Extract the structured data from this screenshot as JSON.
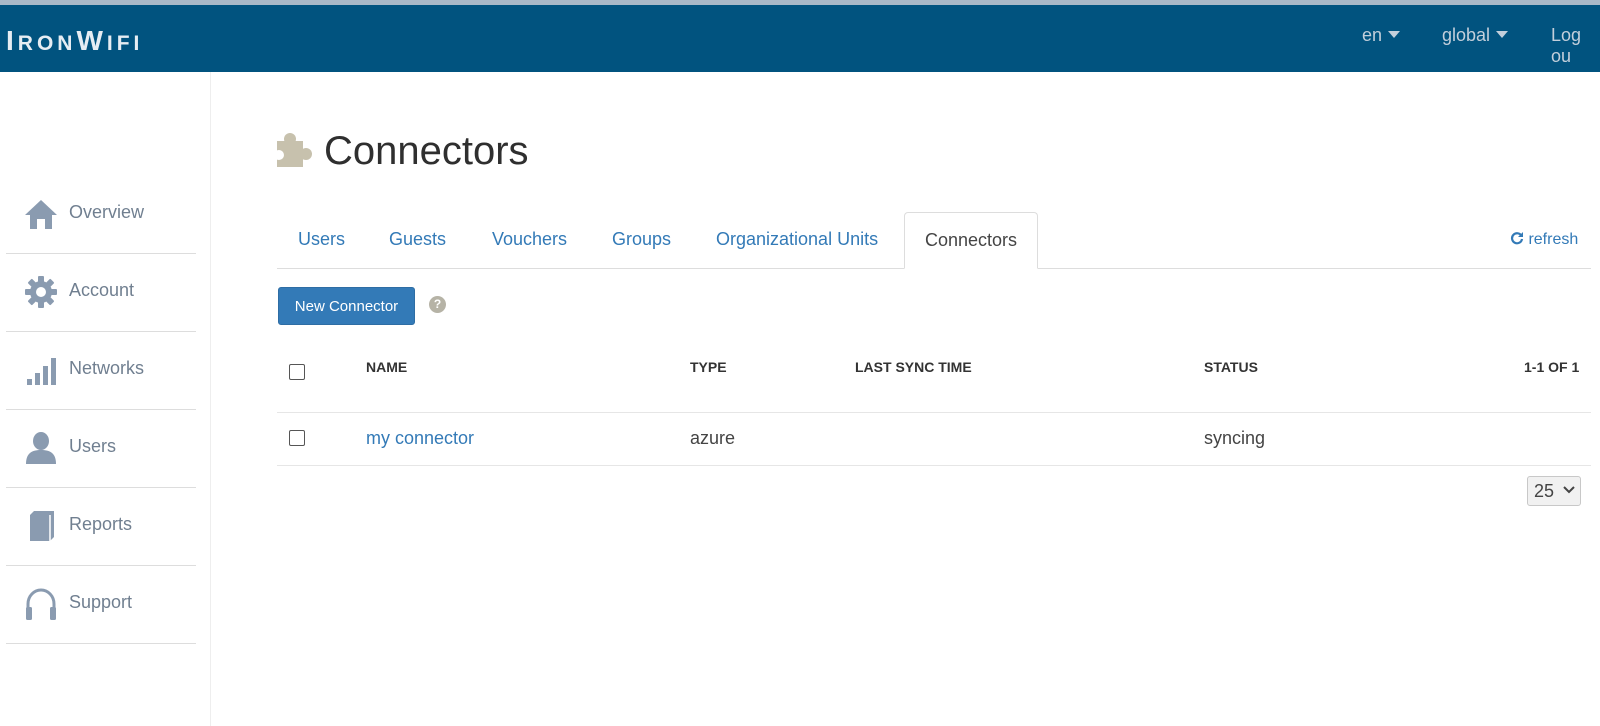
{
  "brand": {
    "first_big": "I",
    "first_rest": "RON",
    "second_big": "W",
    "second_rest": "IFI"
  },
  "topnav": {
    "language": "en",
    "scope": "global",
    "logout": "Log ou"
  },
  "sidebar": {
    "items": [
      {
        "label": "Overview",
        "icon": "home-icon"
      },
      {
        "label": "Account",
        "icon": "gear-icon"
      },
      {
        "label": "Networks",
        "icon": "signal-bars-icon"
      },
      {
        "label": "Users",
        "icon": "user-icon"
      },
      {
        "label": "Reports",
        "icon": "book-icon"
      },
      {
        "label": "Support",
        "icon": "headphones-icon"
      }
    ]
  },
  "page": {
    "title": "Connectors",
    "title_icon": "puzzle-icon"
  },
  "tabs": [
    {
      "label": "Users",
      "active": false
    },
    {
      "label": "Guests",
      "active": false
    },
    {
      "label": "Vouchers",
      "active": false
    },
    {
      "label": "Groups",
      "active": false
    },
    {
      "label": "Organizational Units",
      "active": false
    },
    {
      "label": "Connectors",
      "active": true
    }
  ],
  "toolbar": {
    "refresh_label": "refresh",
    "new_button": "New Connector",
    "help_glyph": "?"
  },
  "table": {
    "columns": [
      "NAME",
      "TYPE",
      "LAST SYNC TIME",
      "STATUS"
    ],
    "count_label": "1-1 OF 1",
    "rows": [
      {
        "name": "my connector",
        "type": "azure",
        "last_sync": "",
        "status": "syncing"
      }
    ]
  },
  "pagination": {
    "page_size": "25"
  },
  "colors": {
    "navbar": "#01537f",
    "accent": "#337ab7",
    "sidebar_icon": "#8a9bb0",
    "puzzle_icon": "#c7c1ad"
  }
}
